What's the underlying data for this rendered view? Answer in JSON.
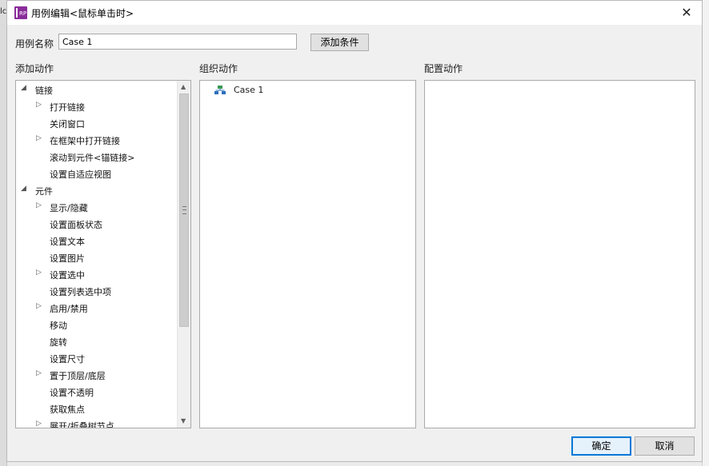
{
  "background_fragment": "lc",
  "window": {
    "title": "用例编辑<鼠标单击时>",
    "app_icon": "rp-app-icon",
    "close_icon": "close-icon"
  },
  "case_name": {
    "label": "用例名称",
    "value": "Case 1"
  },
  "add_condition_label": "添加条件",
  "sections": {
    "add_action": "添加动作",
    "organize_action": "组织动作",
    "configure_action": "配置动作"
  },
  "tree": [
    {
      "label": "链接",
      "level": 0,
      "expander": "expanded"
    },
    {
      "label": "打开链接",
      "level": 1,
      "expander": "collapsed"
    },
    {
      "label": "关闭窗口",
      "level": 1,
      "expander": "none"
    },
    {
      "label": "在框架中打开链接",
      "level": 1,
      "expander": "collapsed"
    },
    {
      "label": "滚动到元件<锚链接>",
      "level": 1,
      "expander": "none"
    },
    {
      "label": "设置自适应视图",
      "level": 1,
      "expander": "none"
    },
    {
      "label": "元件",
      "level": 0,
      "expander": "expanded"
    },
    {
      "label": "显示/隐藏",
      "level": 1,
      "expander": "collapsed"
    },
    {
      "label": "设置面板状态",
      "level": 1,
      "expander": "none"
    },
    {
      "label": "设置文本",
      "level": 1,
      "expander": "none"
    },
    {
      "label": "设置图片",
      "level": 1,
      "expander": "none"
    },
    {
      "label": "设置选中",
      "level": 1,
      "expander": "collapsed"
    },
    {
      "label": "设置列表选中项",
      "level": 1,
      "expander": "none"
    },
    {
      "label": "启用/禁用",
      "level": 1,
      "expander": "collapsed"
    },
    {
      "label": "移动",
      "level": 1,
      "expander": "none"
    },
    {
      "label": "旋转",
      "level": 1,
      "expander": "none"
    },
    {
      "label": "设置尺寸",
      "level": 1,
      "expander": "none"
    },
    {
      "label": "置于顶层/底层",
      "level": 1,
      "expander": "collapsed"
    },
    {
      "label": "设置不透明",
      "level": 1,
      "expander": "none"
    },
    {
      "label": "获取焦点",
      "level": 1,
      "expander": "none"
    },
    {
      "label": "展开/折叠树节点",
      "level": 1,
      "expander": "collapsed"
    }
  ],
  "organize": {
    "case_label": "Case 1",
    "case_icon": "case-tree-icon"
  },
  "buttons": {
    "ok": "确定",
    "cancel": "取消"
  },
  "colors": {
    "accent": "#0078d7",
    "app_icon": "#8a2c9a",
    "case_icon_green": "#3a9a52",
    "case_icon_blue": "#2c6fbd"
  }
}
